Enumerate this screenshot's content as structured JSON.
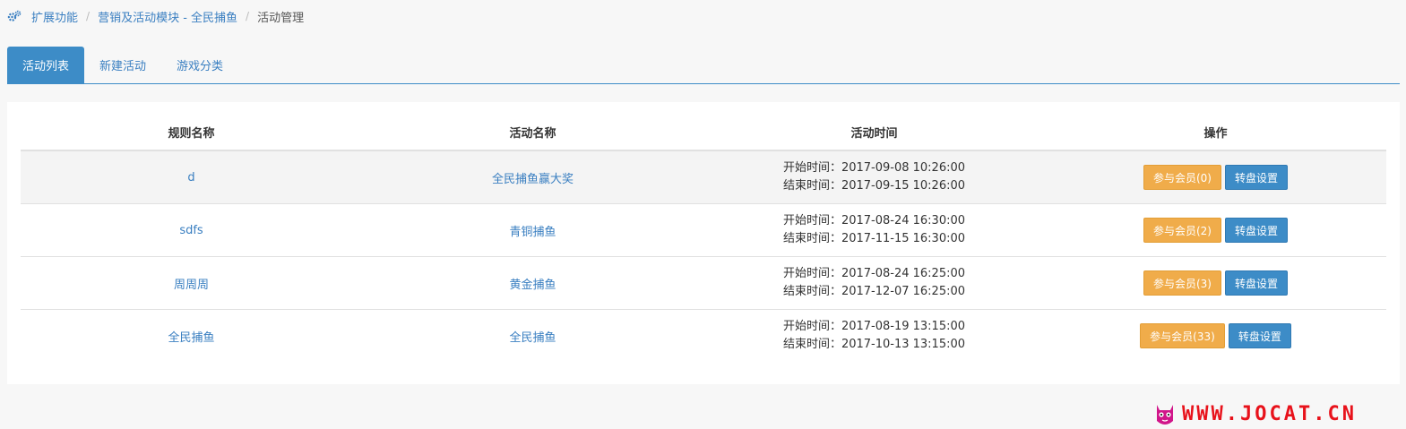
{
  "breadcrumb": {
    "items": [
      "扩展功能",
      "营销及活动模块 - 全民捕鱼",
      "活动管理"
    ]
  },
  "tabs": [
    {
      "label": "活动列表",
      "active": true
    },
    {
      "label": "新建活动",
      "active": false
    },
    {
      "label": "游戏分类",
      "active": false
    }
  ],
  "table": {
    "headers": [
      "规则名称",
      "活动名称",
      "活动时间",
      "操作"
    ],
    "rows": [
      {
        "rule_name": "d",
        "activity_name": "全民捕鱼赢大奖",
        "start_time": "开始时间：2017-09-08 10:26:00",
        "end_time": "结束时间：2017-09-15 10:26:00",
        "members_button": "参与会员(0)",
        "wheel_button": "转盘设置"
      },
      {
        "rule_name": "sdfs",
        "activity_name": "青铜捕鱼",
        "start_time": "开始时间：2017-08-24 16:30:00",
        "end_time": "结束时间：2017-11-15 16:30:00",
        "members_button": "参与会员(2)",
        "wheel_button": "转盘设置"
      },
      {
        "rule_name": "周周周",
        "activity_name": "黄金捕鱼",
        "start_time": "开始时间：2017-08-24 16:25:00",
        "end_time": "结束时间：2017-12-07 16:25:00",
        "members_button": "参与会员(3)",
        "wheel_button": "转盘设置"
      },
      {
        "rule_name": "全民捕鱼",
        "activity_name": "全民捕鱼",
        "start_time": "开始时间：2017-08-19 13:15:00",
        "end_time": "结束时间：2017-10-13 13:15:00",
        "members_button": "参与会员(33)",
        "wheel_button": "转盘设置"
      }
    ]
  },
  "watermark": {
    "text": "WWW.JOCAT.CN"
  },
  "icons": {
    "breadcrumb_icon": "cogs-icon",
    "watermark_icon": "cat-logo-icon"
  },
  "colors": {
    "primary": "#3d8cc7",
    "warning": "#f0ac4a",
    "link": "#3a7fc1",
    "watermark": "#e8121b"
  }
}
